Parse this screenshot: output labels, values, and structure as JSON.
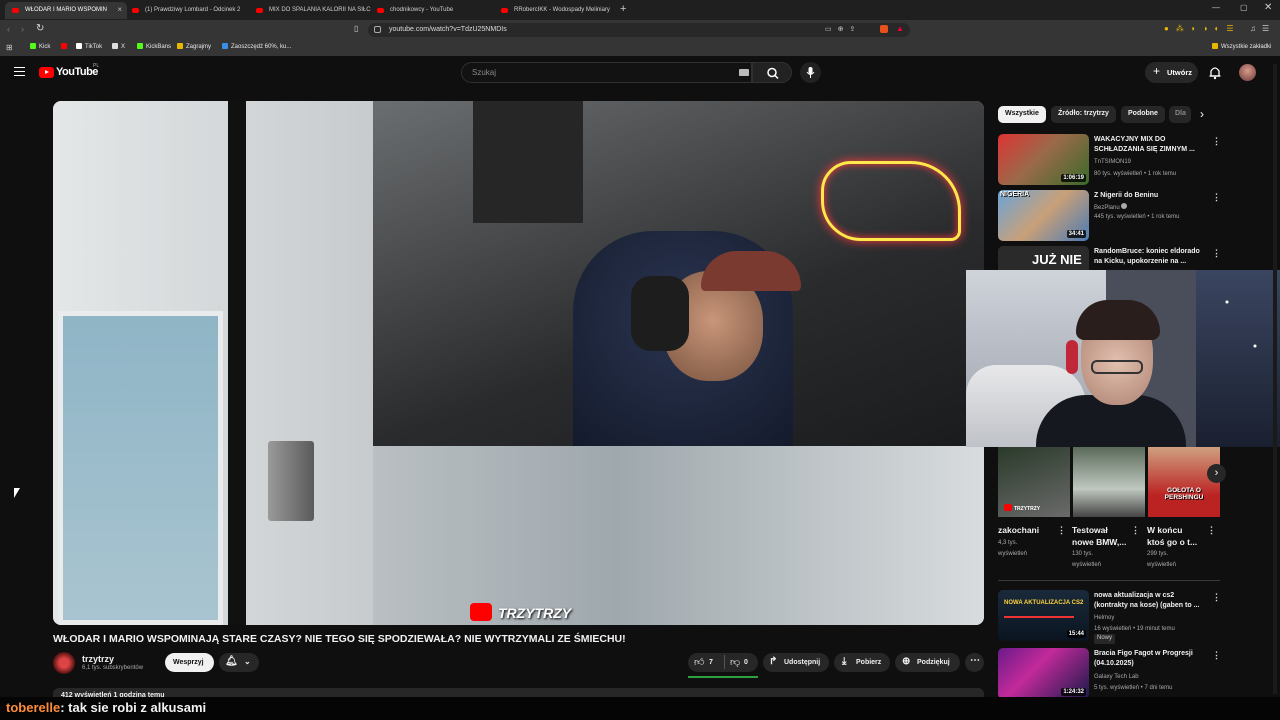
{
  "browser": {
    "tabs": [
      {
        "label": "WŁODAR I MARIO WSPOMIN"
      },
      {
        "label": "(1) Prawdziwy Lombard - Odcinek 2"
      },
      {
        "label": "MIX DO SPALANIA KALORII NA SIŁC"
      },
      {
        "label": "chodnikowcy - YouTube"
      },
      {
        "label": "RRobercIKK - Wodospady Meliniary"
      }
    ],
    "url": "youtube.com/watch?v=TdzU25NMDIs",
    "bookmarks": [
      {
        "label": "Kick"
      },
      {
        "label": "TikTok"
      },
      {
        "label": "X"
      },
      {
        "label": "KickBans"
      },
      {
        "label": "Zagrajmy"
      },
      {
        "label": "Zaoszczędź 60%, ku..."
      }
    ],
    "all_bookmarks": "Wszystkie zakładki"
  },
  "youtube": {
    "logo": "YouTube",
    "logo_region": "PL",
    "search_placeholder": "Szukaj",
    "create_label": "Utwórz"
  },
  "video": {
    "watermark": "TRZYTRZY",
    "title": "WŁODAR I MARIO WSPOMINAJĄ STARE CZASY? NIE TEGO SIĘ SPODZIEWAŁA? NIE WYTRZYMALI ZE ŚMIECHU!",
    "channel": "trzytrzy",
    "subscribers": "6,1 tys. subskrybentów",
    "support_label": "Wesprzyj",
    "likes": "7",
    "dislikes": "0",
    "share_label": "Udostępnij",
    "download_label": "Pobierz",
    "thanks_label": "Podziękuj",
    "description_preview": "412 wyświetleń 1 godzina temu"
  },
  "filter_chips": [
    "Wszystkie",
    "Źródło: trzytrzy",
    "Podobne",
    "Dla"
  ],
  "recommendations": [
    {
      "title1": "WAKACYJNY MIX DO",
      "title2": "SCHŁADZANIA SIĘ ZIMNYM ...",
      "channel": "TnTSIMON19",
      "meta": "80 tys. wyświetleń • 1 rok temu",
      "duration": "1:06:19"
    },
    {
      "title1": "Z Nigerii do Beninu",
      "title2": "",
      "channel": "BezPlanu",
      "meta": "445 tys. wyświetleń • 1 rok temu",
      "duration": "34:41",
      "thumb_text": "NIGERIA"
    },
    {
      "title1": "RandomBruce: koniec eldorado",
      "title2": "na Kicku, upokorzenie na ...",
      "channel": "",
      "meta": "",
      "duration": "",
      "thumb_text": "JUŻ NIE"
    }
  ],
  "shorts": [
    {
      "title1": "zakochani",
      "title2": "",
      "views1": "4,3 tys.",
      "views2": "wyświetleń",
      "thumb_text": "TRZYTRZY"
    },
    {
      "title1": "Testował",
      "title2": "nowe BMW,...",
      "views1": "130 tys.",
      "views2": "wyświetleń"
    },
    {
      "title1": "W końcu",
      "title2": "ktoś go o t...",
      "views1": "299 tys.",
      "views2": "wyświetleń",
      "thumb_text": "GOŁOTA O PERSHINGU"
    }
  ],
  "recommendations2": [
    {
      "title1": "nowa aktualizacja w cs2",
      "title2": "(kontrakty na kose) (gaben to ...",
      "channel": "Helmoy",
      "meta": "16 wyświetleń • 19 minut temu",
      "badge": "Nowy",
      "duration": "15:44",
      "thumb_text": "NOWA AKTUALIZACJA CS2"
    },
    {
      "title1": "Bracia Figo Fagot w Progresji",
      "title2": "(04.10.2025)",
      "channel": "Galaxy Tech Lab",
      "meta": "5 tys. wyświetleń • 7 dni temu",
      "duration": "1:24:32"
    }
  ],
  "chat": {
    "user": "toberelle",
    "message": ": tak sie robi z alkusami",
    "user_color": "#ff8c3a"
  }
}
